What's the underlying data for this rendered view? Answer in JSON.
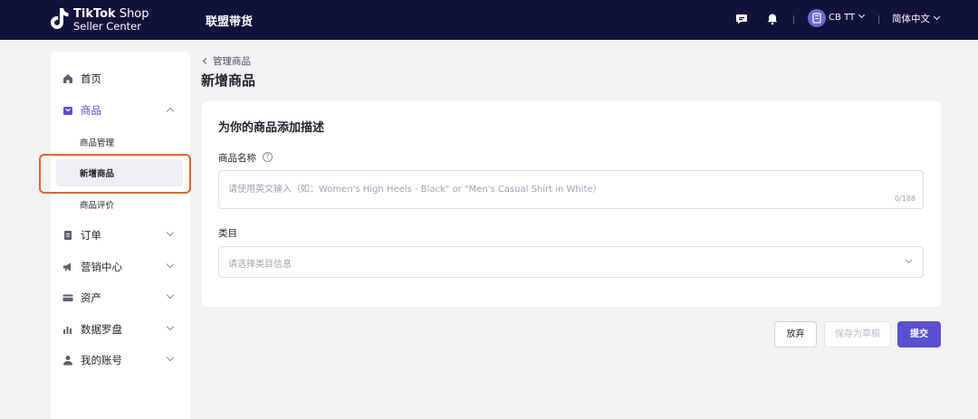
{
  "header": {
    "logo_line1_bold": "TikTok",
    "logo_line1_rest": " Shop",
    "logo_line2": "Seller Center",
    "module_title": "联盟带货",
    "account_name": "CB TT",
    "language": "简体中文"
  },
  "sidebar": {
    "items": [
      {
        "label": "首页",
        "icon": "home-icon"
      },
      {
        "label": "商品",
        "icon": "product-icon",
        "expanded": true
      },
      {
        "label": "订单",
        "icon": "order-icon"
      },
      {
        "label": "营销中心",
        "icon": "megaphone-icon"
      },
      {
        "label": "资产",
        "icon": "card-icon"
      },
      {
        "label": "数据罗盘",
        "icon": "chart-icon"
      },
      {
        "label": "我的账号",
        "icon": "user-icon"
      }
    ],
    "sub_items": [
      {
        "label": "商品管理"
      },
      {
        "label": "新增商品",
        "selected": true
      },
      {
        "label": "商品评价"
      }
    ]
  },
  "main": {
    "breadcrumb": "管理商品",
    "title": "新增商品",
    "card_title": "为你的商品添加描述",
    "name_label": "商品名称",
    "help_glyph": "?",
    "name_placeholder": "请使用英文输入（如：Women's High Heels - Black\" or \"Men's Casual Shirt in White）",
    "name_count": "0/188",
    "category_label": "类目",
    "category_placeholder": "请选择类目信息"
  },
  "actions": {
    "discard": "放弃",
    "save_draft": "保存为草稿",
    "submit": "提交"
  },
  "colors": {
    "topbar": "#10123b",
    "accent": "#5a4fd0",
    "highlight": "#e2622d"
  }
}
